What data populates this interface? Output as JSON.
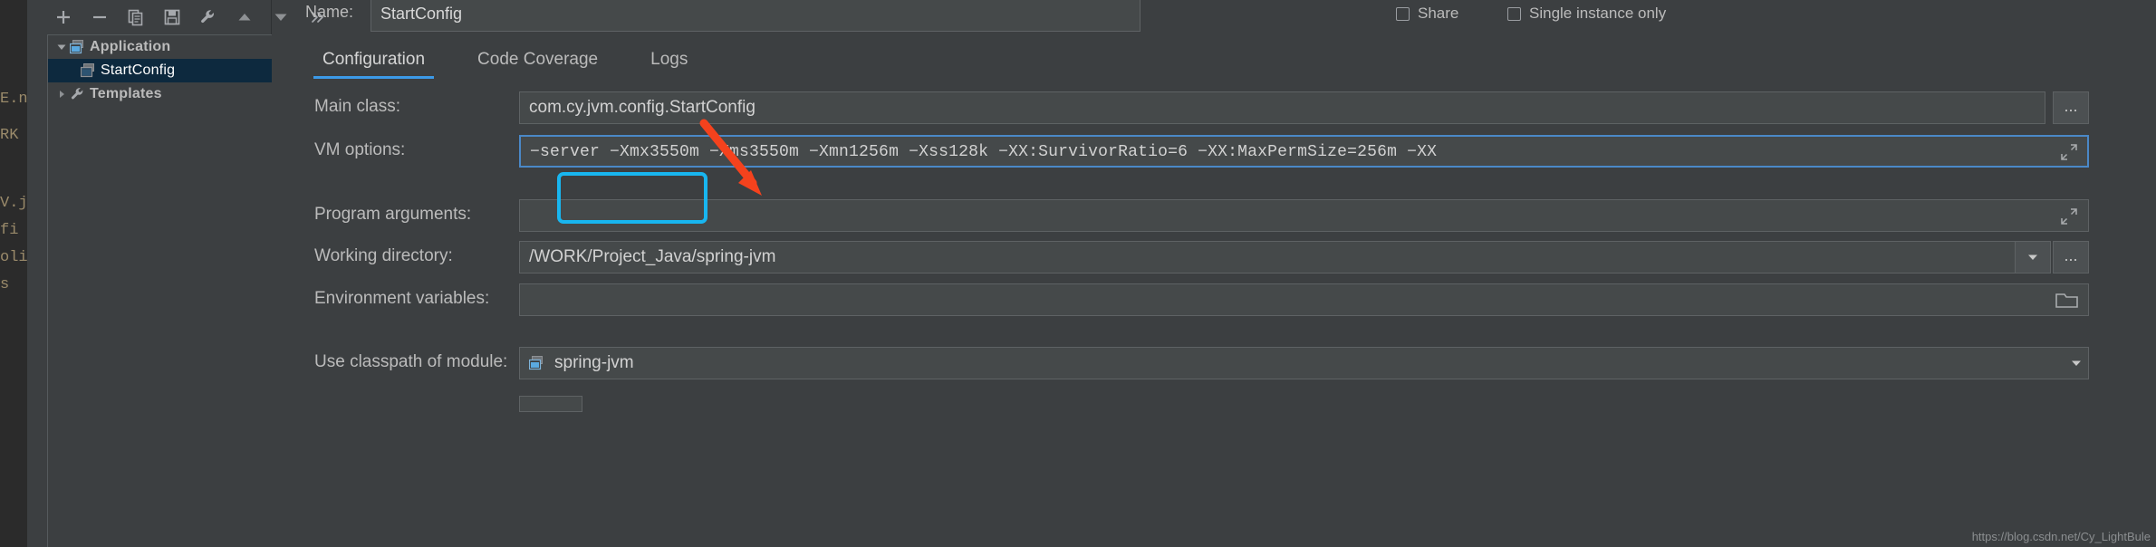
{
  "editor_sliver": {
    "fragments": [
      "E.n",
      "RK",
      "V.j",
      "fi",
      "oli",
      "s"
    ]
  },
  "toolbar": {
    "buttons": [
      {
        "name": "add-button",
        "icon": "plus-icon",
        "label": "+"
      },
      {
        "name": "remove-button",
        "icon": "minus-icon",
        "label": "−"
      },
      {
        "name": "copy-button",
        "icon": "copy-icon",
        "label": "Copy"
      },
      {
        "name": "save-button",
        "icon": "save-icon",
        "label": "Save"
      },
      {
        "name": "edit-templates-button",
        "icon": "wrench-icon",
        "label": "Edit Templates"
      },
      {
        "name": "move-up-button",
        "icon": "triangle-up-icon",
        "label": "Move Up"
      },
      {
        "name": "move-down-button",
        "icon": "triangle-down-icon",
        "label": "Move Down"
      },
      {
        "name": "more-button",
        "icon": "chevron-double-right-icon",
        "label": "»"
      }
    ]
  },
  "tree": {
    "nodes": [
      {
        "label": "Application",
        "expanded": true,
        "icon": "application-icon",
        "selected": false,
        "indent": false
      },
      {
        "label": "StartConfig",
        "expanded": null,
        "icon": "run-config-icon",
        "selected": true,
        "indent": true
      },
      {
        "label": "Templates",
        "expanded": false,
        "icon": "wrench-icon",
        "selected": false,
        "indent": false
      }
    ]
  },
  "header": {
    "name_label": "Name:",
    "name_value": "StartConfig",
    "name_placeholder": "",
    "share_label": "Share",
    "share_checked": false,
    "single_instance_label": "Single instance only",
    "single_instance_checked": false
  },
  "tabs": [
    {
      "label": "Configuration",
      "active": true
    },
    {
      "label": "Code Coverage",
      "active": false
    },
    {
      "label": "Logs",
      "active": false
    }
  ],
  "form": {
    "main_class": {
      "label": "Main class:",
      "value": "com.cy.jvm.config.StartConfig",
      "browse_label": "..."
    },
    "vm_options": {
      "label": "VM options:",
      "value": "−server −Xmx3550m −Xms3550m −Xmn1256m −Xss128k −XX:SurvivorRatio=6 −XX:MaxPermSize=256m −XX",
      "expand_icon": "expand-diagonal-icon"
    },
    "program_arguments": {
      "label": "Program arguments:",
      "value": "",
      "expand_icon": "expand-diagonal-icon"
    },
    "working_directory": {
      "label": "Working directory:",
      "value": "/WORK/Project_Java/spring-jvm",
      "dropdown_icon": "chevron-down-icon",
      "browse_label": "..."
    },
    "environment_variables": {
      "label": "Environment variables:",
      "value": "",
      "browse_icon": "folder-icon"
    },
    "use_classpath_of_module": {
      "label": "Use classpath of module:",
      "value": "spring-jvm",
      "module_icon": "module-icon",
      "dropdown_icon": "chevron-down-icon"
    }
  },
  "annotations": {
    "highlight_color": "#18b6f0",
    "arrow_color": "#f5421d",
    "highlight_target": "VM options:",
    "arrow_target": "vm-options-input"
  },
  "watermark": "https://blog.csdn.net/Cy_LightBule"
}
